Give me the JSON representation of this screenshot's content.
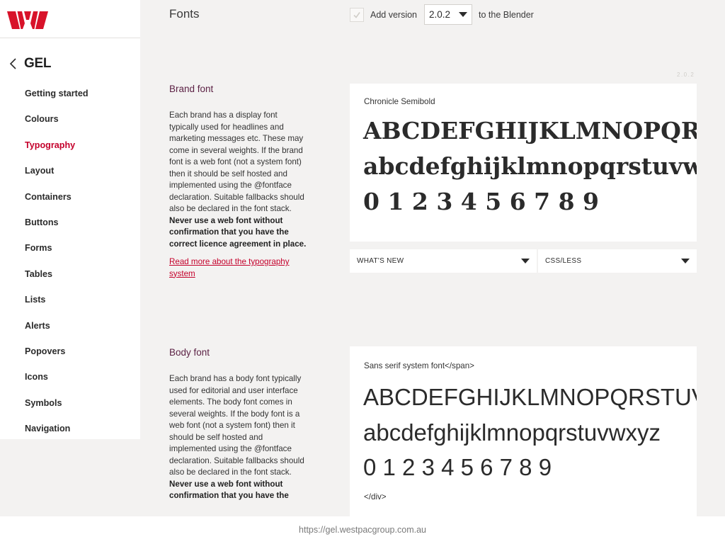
{
  "brand": {
    "accent": "#c4002b",
    "logo_color": "#d8132a"
  },
  "sidebar": {
    "back_label": "GEL",
    "items": [
      {
        "label": "Getting started"
      },
      {
        "label": "Colours"
      },
      {
        "label": "Typography",
        "active": true
      },
      {
        "label": "Layout"
      },
      {
        "label": "Containers"
      },
      {
        "label": "Buttons"
      },
      {
        "label": "Forms"
      },
      {
        "label": "Tables"
      },
      {
        "label": "Lists"
      },
      {
        "label": "Alerts"
      },
      {
        "label": "Popovers"
      },
      {
        "label": "Icons"
      },
      {
        "label": "Symbols"
      },
      {
        "label": "Navigation"
      }
    ]
  },
  "header": {
    "title": "Fonts",
    "add_version_label": "Add version",
    "version_value": "2.0.2",
    "blender_label": "to the Blender",
    "version_tag": "2.0.2"
  },
  "brand_font": {
    "title": "Brand font",
    "description": "Each brand has a display font typically used for headlines and marketing messages etc. These may come in several weights. If the brand font is a web font (not a system font) then it should be self hosted and implemented using the @fontface declaration. Suitable fallbacks should also be declared in the font stack.",
    "warning": "Never use a web font without confirmation that you have the correct licence agreement in place.",
    "link": "Read more about the typography system",
    "card_label": "Chronicle Semibold",
    "uppercase": "ABCDEFGHIJKLMNOPQRSTUVWXYZ",
    "lowercase": "abcdefghijklmnopqrstuvwxyz",
    "digits": "0 1 2 3 4 5 6 7 8 9"
  },
  "dropdowns": {
    "whats_new": "WHAT'S NEW",
    "css_less": "CSS/LESS"
  },
  "body_font": {
    "title": "Body font",
    "description": "Each brand has a body font typically used for editorial and user interface elements. The body font comes in several weights. If the body font is a web font (not a system font) then it should be self hosted and implemented using the @fontface declaration. Suitable fallbacks should also be declared in the font stack.",
    "warning": "Never use a web font without confirmation that you have the",
    "card_label": "Sans serif system font</span>",
    "uppercase": "ABCDEFGHIJKLMNOPQRSTUVWXYZ",
    "lowercase": "abcdefghijklmnopqrstuvwxyz",
    "digits": "0 1 2 3 4 5 6 7 8 9",
    "closing_tag": "</div>"
  },
  "footer": {
    "url": "https://gel.westpacgroup.com.au"
  }
}
